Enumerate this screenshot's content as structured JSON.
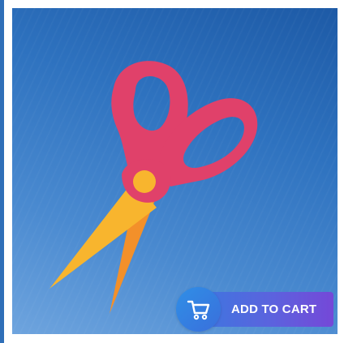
{
  "product": {
    "image_subject": "scissors",
    "colors": {
      "background_top": "#1d5aa6",
      "background_bottom": "#6ea4de",
      "handle": "#e0416a",
      "blade_light": "#f8b52e",
      "blade_dark": "#f3902a",
      "pivot": "#f8b52e"
    }
  },
  "cart": {
    "label": "ADD TO CART",
    "icon": "cart-icon",
    "colors": {
      "start": "#3b78e0",
      "end": "#7548d8"
    }
  }
}
